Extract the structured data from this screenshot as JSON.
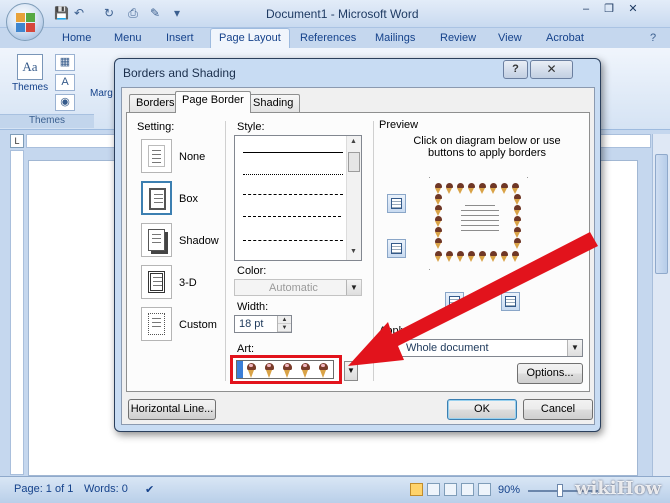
{
  "window": {
    "title": "Document1 - Microsoft Word",
    "controls": {
      "minimize": "–",
      "restore": "❐",
      "close": "✕"
    }
  },
  "quick_access": {
    "save": "💾",
    "undo": "↶",
    "redo": "↻",
    "customize": "▾"
  },
  "ribbon": {
    "tabs": [
      "Home",
      "Menu",
      "Insert",
      "Page Layout",
      "References",
      "Mailings",
      "Review",
      "View",
      "Acrobat"
    ],
    "active_tab": "Page Layout",
    "themes_group": {
      "themes_label": "Themes",
      "group_label": "Themes",
      "icon_glyph": "Aa",
      "font_btn_glyph": "A",
      "margins_label": "Marg"
    }
  },
  "ruler": {
    "corner_glyph": "L"
  },
  "dialog": {
    "title": "Borders and Shading",
    "help_glyph": "?",
    "close_glyph": "✕",
    "tabs": [
      "Borders",
      "Page Border",
      "Shading"
    ],
    "active_tab": "Page Border",
    "setting": {
      "label": "Setting:",
      "options": [
        "None",
        "Box",
        "Shadow",
        "3-D",
        "Custom"
      ],
      "selected": "Box"
    },
    "style": {
      "label": "Style:"
    },
    "color": {
      "label": "Color:",
      "value": "Automatic"
    },
    "width": {
      "label": "Width:",
      "value": "18 pt"
    },
    "art": {
      "label": "Art:",
      "selected": "ice cream cones"
    },
    "preview": {
      "label": "Preview",
      "hint": "Click on diagram below or use buttons to apply borders"
    },
    "apply_to": {
      "label": "Apply to:",
      "value": "Whole document"
    },
    "buttons": {
      "options": "Options...",
      "horizontal_line": "Horizontal Line...",
      "ok": "OK",
      "cancel": "Cancel"
    }
  },
  "status_bar": {
    "page": "Page: 1 of 1",
    "words": "Words: 0",
    "zoom": "90%"
  },
  "watermark": "wikiHow",
  "colors": {
    "annotation_red": "#e2131c",
    "office_blue": "#c5d7ee",
    "selected_border": "#3c7fb1"
  }
}
